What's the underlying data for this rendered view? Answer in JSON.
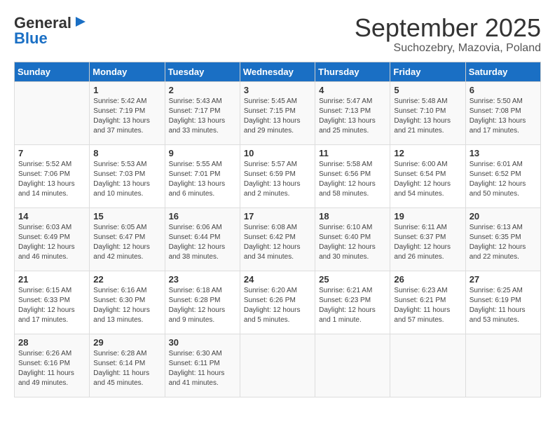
{
  "logo": {
    "part1": "General",
    "part2": "Blue"
  },
  "title": "September 2025",
  "subtitle": "Suchozebry, Mazovia, Poland",
  "days_of_week": [
    "Sunday",
    "Monday",
    "Tuesday",
    "Wednesday",
    "Thursday",
    "Friday",
    "Saturday"
  ],
  "weeks": [
    [
      {
        "day": "",
        "info": ""
      },
      {
        "day": "1",
        "info": "Sunrise: 5:42 AM\nSunset: 7:19 PM\nDaylight: 13 hours\nand 37 minutes."
      },
      {
        "day": "2",
        "info": "Sunrise: 5:43 AM\nSunset: 7:17 PM\nDaylight: 13 hours\nand 33 minutes."
      },
      {
        "day": "3",
        "info": "Sunrise: 5:45 AM\nSunset: 7:15 PM\nDaylight: 13 hours\nand 29 minutes."
      },
      {
        "day": "4",
        "info": "Sunrise: 5:47 AM\nSunset: 7:13 PM\nDaylight: 13 hours\nand 25 minutes."
      },
      {
        "day": "5",
        "info": "Sunrise: 5:48 AM\nSunset: 7:10 PM\nDaylight: 13 hours\nand 21 minutes."
      },
      {
        "day": "6",
        "info": "Sunrise: 5:50 AM\nSunset: 7:08 PM\nDaylight: 13 hours\nand 17 minutes."
      }
    ],
    [
      {
        "day": "7",
        "info": "Sunrise: 5:52 AM\nSunset: 7:06 PM\nDaylight: 13 hours\nand 14 minutes."
      },
      {
        "day": "8",
        "info": "Sunrise: 5:53 AM\nSunset: 7:03 PM\nDaylight: 13 hours\nand 10 minutes."
      },
      {
        "day": "9",
        "info": "Sunrise: 5:55 AM\nSunset: 7:01 PM\nDaylight: 13 hours\nand 6 minutes."
      },
      {
        "day": "10",
        "info": "Sunrise: 5:57 AM\nSunset: 6:59 PM\nDaylight: 13 hours\nand 2 minutes."
      },
      {
        "day": "11",
        "info": "Sunrise: 5:58 AM\nSunset: 6:56 PM\nDaylight: 12 hours\nand 58 minutes."
      },
      {
        "day": "12",
        "info": "Sunrise: 6:00 AM\nSunset: 6:54 PM\nDaylight: 12 hours\nand 54 minutes."
      },
      {
        "day": "13",
        "info": "Sunrise: 6:01 AM\nSunset: 6:52 PM\nDaylight: 12 hours\nand 50 minutes."
      }
    ],
    [
      {
        "day": "14",
        "info": "Sunrise: 6:03 AM\nSunset: 6:49 PM\nDaylight: 12 hours\nand 46 minutes."
      },
      {
        "day": "15",
        "info": "Sunrise: 6:05 AM\nSunset: 6:47 PM\nDaylight: 12 hours\nand 42 minutes."
      },
      {
        "day": "16",
        "info": "Sunrise: 6:06 AM\nSunset: 6:44 PM\nDaylight: 12 hours\nand 38 minutes."
      },
      {
        "day": "17",
        "info": "Sunrise: 6:08 AM\nSunset: 6:42 PM\nDaylight: 12 hours\nand 34 minutes."
      },
      {
        "day": "18",
        "info": "Sunrise: 6:10 AM\nSunset: 6:40 PM\nDaylight: 12 hours\nand 30 minutes."
      },
      {
        "day": "19",
        "info": "Sunrise: 6:11 AM\nSunset: 6:37 PM\nDaylight: 12 hours\nand 26 minutes."
      },
      {
        "day": "20",
        "info": "Sunrise: 6:13 AM\nSunset: 6:35 PM\nDaylight: 12 hours\nand 22 minutes."
      }
    ],
    [
      {
        "day": "21",
        "info": "Sunrise: 6:15 AM\nSunset: 6:33 PM\nDaylight: 12 hours\nand 17 minutes."
      },
      {
        "day": "22",
        "info": "Sunrise: 6:16 AM\nSunset: 6:30 PM\nDaylight: 12 hours\nand 13 minutes."
      },
      {
        "day": "23",
        "info": "Sunrise: 6:18 AM\nSunset: 6:28 PM\nDaylight: 12 hours\nand 9 minutes."
      },
      {
        "day": "24",
        "info": "Sunrise: 6:20 AM\nSunset: 6:26 PM\nDaylight: 12 hours\nand 5 minutes."
      },
      {
        "day": "25",
        "info": "Sunrise: 6:21 AM\nSunset: 6:23 PM\nDaylight: 12 hours\nand 1 minute."
      },
      {
        "day": "26",
        "info": "Sunrise: 6:23 AM\nSunset: 6:21 PM\nDaylight: 11 hours\nand 57 minutes."
      },
      {
        "day": "27",
        "info": "Sunrise: 6:25 AM\nSunset: 6:19 PM\nDaylight: 11 hours\nand 53 minutes."
      }
    ],
    [
      {
        "day": "28",
        "info": "Sunrise: 6:26 AM\nSunset: 6:16 PM\nDaylight: 11 hours\nand 49 minutes."
      },
      {
        "day": "29",
        "info": "Sunrise: 6:28 AM\nSunset: 6:14 PM\nDaylight: 11 hours\nand 45 minutes."
      },
      {
        "day": "30",
        "info": "Sunrise: 6:30 AM\nSunset: 6:11 PM\nDaylight: 11 hours\nand 41 minutes."
      },
      {
        "day": "",
        "info": ""
      },
      {
        "day": "",
        "info": ""
      },
      {
        "day": "",
        "info": ""
      },
      {
        "day": "",
        "info": ""
      }
    ]
  ]
}
